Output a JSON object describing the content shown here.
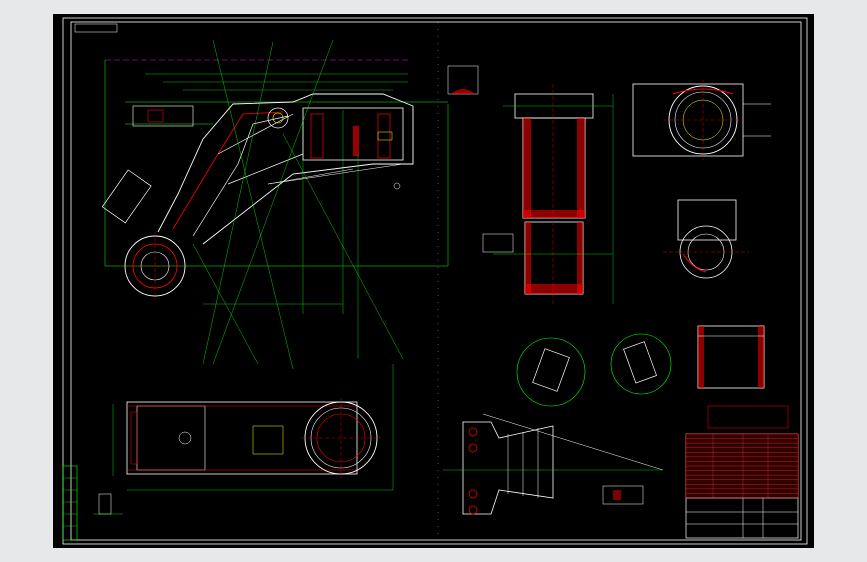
{
  "canvas": {
    "background": "#e6e8ea",
    "sheet_color": "#000000",
    "line_colors": {
      "outline": "#ffffff",
      "dimension": "#00ff00",
      "hatch": "#ff0000",
      "center": "#ff0000",
      "hidden": "#ffff00",
      "magenta": "#ff00ff"
    }
  },
  "views": [
    {
      "id": "main-elevation"
    },
    {
      "id": "top-view"
    },
    {
      "id": "section-a-a"
    },
    {
      "id": "detail-b"
    },
    {
      "id": "detail-c"
    },
    {
      "id": "section-d"
    },
    {
      "id": "section-e"
    },
    {
      "id": "section-f"
    },
    {
      "id": "side-view-right"
    }
  ],
  "title_block": {
    "bom_rows": 14
  }
}
